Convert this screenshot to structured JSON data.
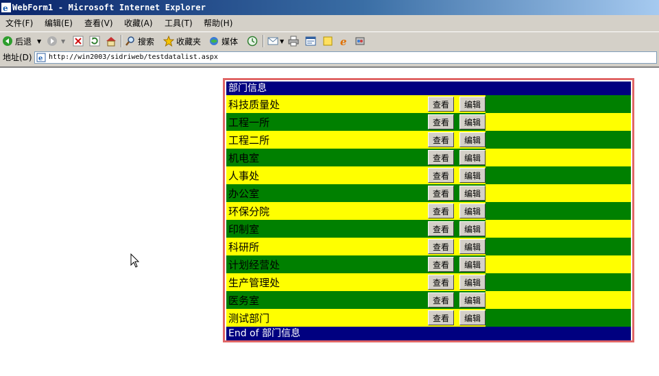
{
  "window": {
    "title": "WebForm1 - Microsoft Internet Explorer"
  },
  "menu": {
    "items": [
      "文件(F)",
      "编辑(E)",
      "查看(V)",
      "收藏(A)",
      "工具(T)",
      "帮助(H)"
    ]
  },
  "toolbar": {
    "back_label": "后退",
    "search_label": "搜索",
    "favorites_label": "收藏夹",
    "media_label": "媒体"
  },
  "address": {
    "label": "地址(D)",
    "url": "http://win2003/sidriweb/testdatalist.aspx"
  },
  "datalist": {
    "header": "部门信息",
    "footer": "End of 部门信息",
    "view_label": "查看",
    "edit_label": "编辑",
    "rows": [
      "科技质量处",
      "工程一所",
      "工程二所",
      "机电室",
      "人事处",
      "办公室",
      "环保分院",
      "印制室",
      "科研所",
      "计划经营处",
      "生产管理处",
      "医务室",
      "测试部门"
    ]
  },
  "colors": {
    "header_bg": "#000080",
    "row_yellow": "#ffff00",
    "row_green": "#008000",
    "border": "#e06666"
  }
}
